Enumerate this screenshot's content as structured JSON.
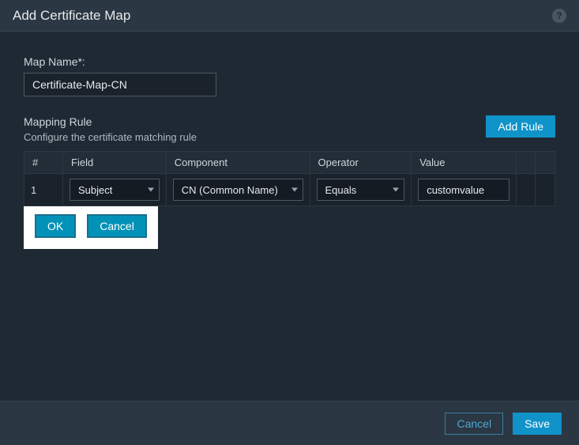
{
  "header": {
    "title": "Add Certificate Map",
    "help_tooltip": "?"
  },
  "form": {
    "map_name_label": "Map Name*:",
    "map_name_value": "Certificate-Map-CN"
  },
  "rule_section": {
    "title": "Mapping Rule",
    "subtitle": "Configure the certificate matching rule",
    "add_rule_label": "Add Rule"
  },
  "grid": {
    "cols": {
      "num": "#",
      "field": "Field",
      "component": "Component",
      "operator": "Operator",
      "value": "Value"
    },
    "row": {
      "num": "1",
      "field": "Subject",
      "component": "CN (Common Name)",
      "operator": "Equals",
      "value": "customvalue"
    }
  },
  "row_actions": {
    "ok": "OK",
    "cancel": "Cancel"
  },
  "footer": {
    "cancel": "Cancel",
    "save": "Save"
  }
}
